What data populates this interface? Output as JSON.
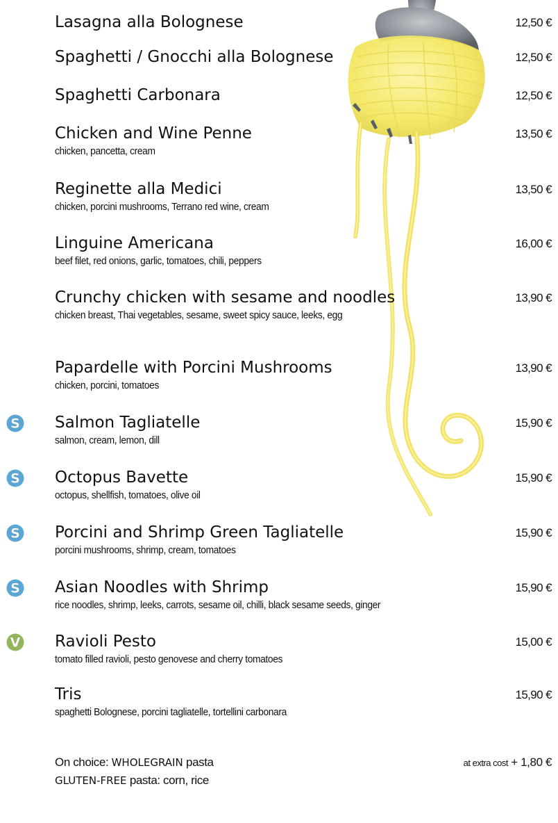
{
  "menu": {
    "items": [
      {
        "name": "Lasagna alla Bolognese",
        "description": "",
        "price": "12,50 €",
        "badge": ""
      },
      {
        "name": "Spaghetti / Gnocchi alla Bolognese",
        "description": "",
        "price": "12,50 €",
        "badge": ""
      },
      {
        "name": "Spaghetti Carbonara",
        "description": "",
        "price": "12,50 €",
        "badge": ""
      },
      {
        "name": "Chicken and Wine Penne",
        "description": "chicken, pancetta, cream",
        "price": "13,50 €",
        "badge": ""
      },
      {
        "name": "Reginette alla Medici",
        "description": "chicken, porcini mushrooms, Terrano red wine, cream",
        "price": "13,50 €",
        "badge": ""
      },
      {
        "name": "Linguine Americana",
        "description": "beef filet, red onions, garlic, tomatoes, chili, peppers",
        "price": "16,00 €",
        "badge": ""
      },
      {
        "name": "Crunchy chicken with sesame and noodles",
        "description": "chicken breast, Thai vegetables, sesame, sweet spicy sauce, leeks, egg",
        "price": "13,90 €",
        "badge": ""
      },
      {
        "name": "Papardelle with Porcini Mushrooms",
        "description": "chicken, porcini, tomatoes",
        "price": "13,90 €",
        "badge": ""
      },
      {
        "name": "Salmon Tagliatelle",
        "description": "salmon, cream, lemon, dill",
        "price": "15,90 €",
        "badge": "S"
      },
      {
        "name": "Octopus Bavette",
        "description": "octopus, shellfish, tomatoes, olive oil",
        "price": "15,90 €",
        "badge": "S"
      },
      {
        "name": "Porcini and Shrimp Green Tagliatelle",
        "description": "porcini mushrooms, shrimp, cream, tomatoes",
        "price": "15,90 €",
        "badge": "S"
      },
      {
        "name": "Asian Noodles with Shrimp",
        "description": "rice noodles, shrimp, leeks, carrots, sesame oil, chilli, black sesame seeds, ginger",
        "price": "15,90 €",
        "badge": "S"
      },
      {
        "name": "Ravioli Pesto",
        "description": "tomato filled ravioli, pesto genovese and cherry tomatoes",
        "price": "15,00 €",
        "badge": "V"
      },
      {
        "name": "Tris",
        "description": "spaghetti Bolognese, porcini tagliatelle, tortellini carbonara",
        "price": "15,90 €",
        "badge": ""
      }
    ]
  },
  "footer": {
    "choice_prefix": "On choice: ",
    "wholegrain": "WHOLEGRAIN",
    "pasta_word": " pasta",
    "extra_label": "at extra cost",
    "extra_price": "+ 1,80 €",
    "glutenfree": "GLUTEN-FREE",
    "glutenfree_rest": " pasta: corn, rice"
  },
  "colors": {
    "text": "#111111",
    "seafood_badge": "#5aa7d6",
    "vegetarian_badge": "#94b65a",
    "pasta_yellow": "#f2e65a",
    "fork_grey": "#8a8f96"
  },
  "icons": {
    "seafood": "seafood-badge-icon",
    "vegetarian": "vegetarian-badge-icon",
    "illustration": "pasta-fork-illustration"
  }
}
